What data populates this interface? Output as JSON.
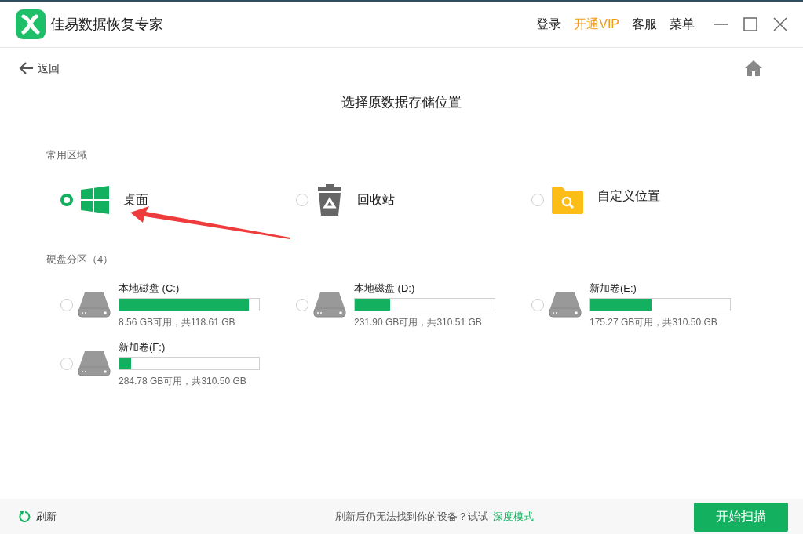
{
  "app": {
    "title": "佳易数据恢复专家"
  },
  "title_bar": {
    "menu": [
      {
        "label": "登录",
        "kind": "plain"
      },
      {
        "label": "开通VIP",
        "kind": "vip"
      },
      {
        "label": "客服",
        "kind": "plain"
      },
      {
        "label": "菜单",
        "kind": "plain"
      }
    ]
  },
  "nav": {
    "back": "返回"
  },
  "heading": "选择原数据存储位置",
  "common": {
    "label": "常用区域",
    "items": [
      {
        "label": "桌面",
        "kind": "desktop",
        "selected": true
      },
      {
        "label": "回收站",
        "kind": "recycle",
        "selected": false
      },
      {
        "label": "自定义位置",
        "kind": "folder",
        "selected": false
      }
    ]
  },
  "disks": {
    "label": "硬盘分区（4）",
    "items": [
      {
        "name": "本地磁盘 (C:)",
        "level": 0.928,
        "info": "8.56 GB可用，共118.61 GB",
        "selected": false
      },
      {
        "name": "本地磁盘 (D:)",
        "level": 0.253,
        "info": "231.90 GB可用，共310.51 GB",
        "selected": false
      },
      {
        "name": "新加卷(E:)",
        "level": 0.436,
        "info": "175.27 GB可用，共310.50 GB",
        "selected": false
      },
      {
        "name": "新加卷(F:)",
        "level": 0.083,
        "info": "284.78 GB可用，共310.50 GB",
        "selected": false
      }
    ]
  },
  "footer": {
    "refresh": "刷新",
    "hint": "刷新后仍无法找到你的设备？试试",
    "link": "深度模式",
    "scan": "开始扫描"
  }
}
